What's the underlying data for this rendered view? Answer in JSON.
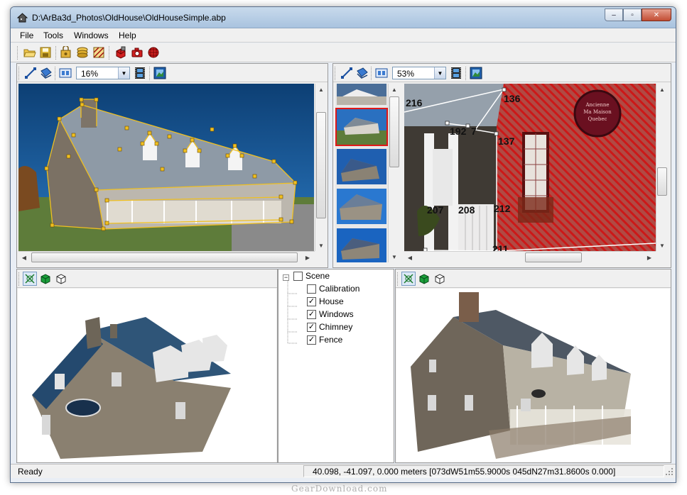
{
  "window": {
    "title": "D:\\ArBa3d_Photos\\OldHouse\\OldHouseSimple.abp",
    "minimize": "–",
    "maximize": "▫",
    "close": "✕"
  },
  "menu": {
    "items": [
      "File",
      "Tools",
      "Windows",
      "Help"
    ]
  },
  "panes": {
    "left_photo": {
      "zoom": "16%"
    },
    "right_photo": {
      "zoom": "53%",
      "point_labels": [
        "216",
        "136",
        "192",
        "7",
        "137",
        "207",
        "208",
        "212",
        "211"
      ]
    }
  },
  "scene_tree": {
    "root": "Scene",
    "items": [
      {
        "label": "Calibration",
        "checked": false
      },
      {
        "label": "House",
        "checked": true
      },
      {
        "label": "Windows",
        "checked": true
      },
      {
        "label": "Chimney",
        "checked": true
      },
      {
        "label": "Fence",
        "checked": true
      }
    ]
  },
  "status": {
    "left": "Ready",
    "coords": "40.098,    -41.097,     0.000 meters [073dW51m55.9000s 045dN27m31.8600s 0.000]"
  },
  "watermark": "GearDownload.com",
  "colors": {
    "accent": "#e01818",
    "wire": "#f0c020",
    "sky": "#0f4f8c"
  }
}
